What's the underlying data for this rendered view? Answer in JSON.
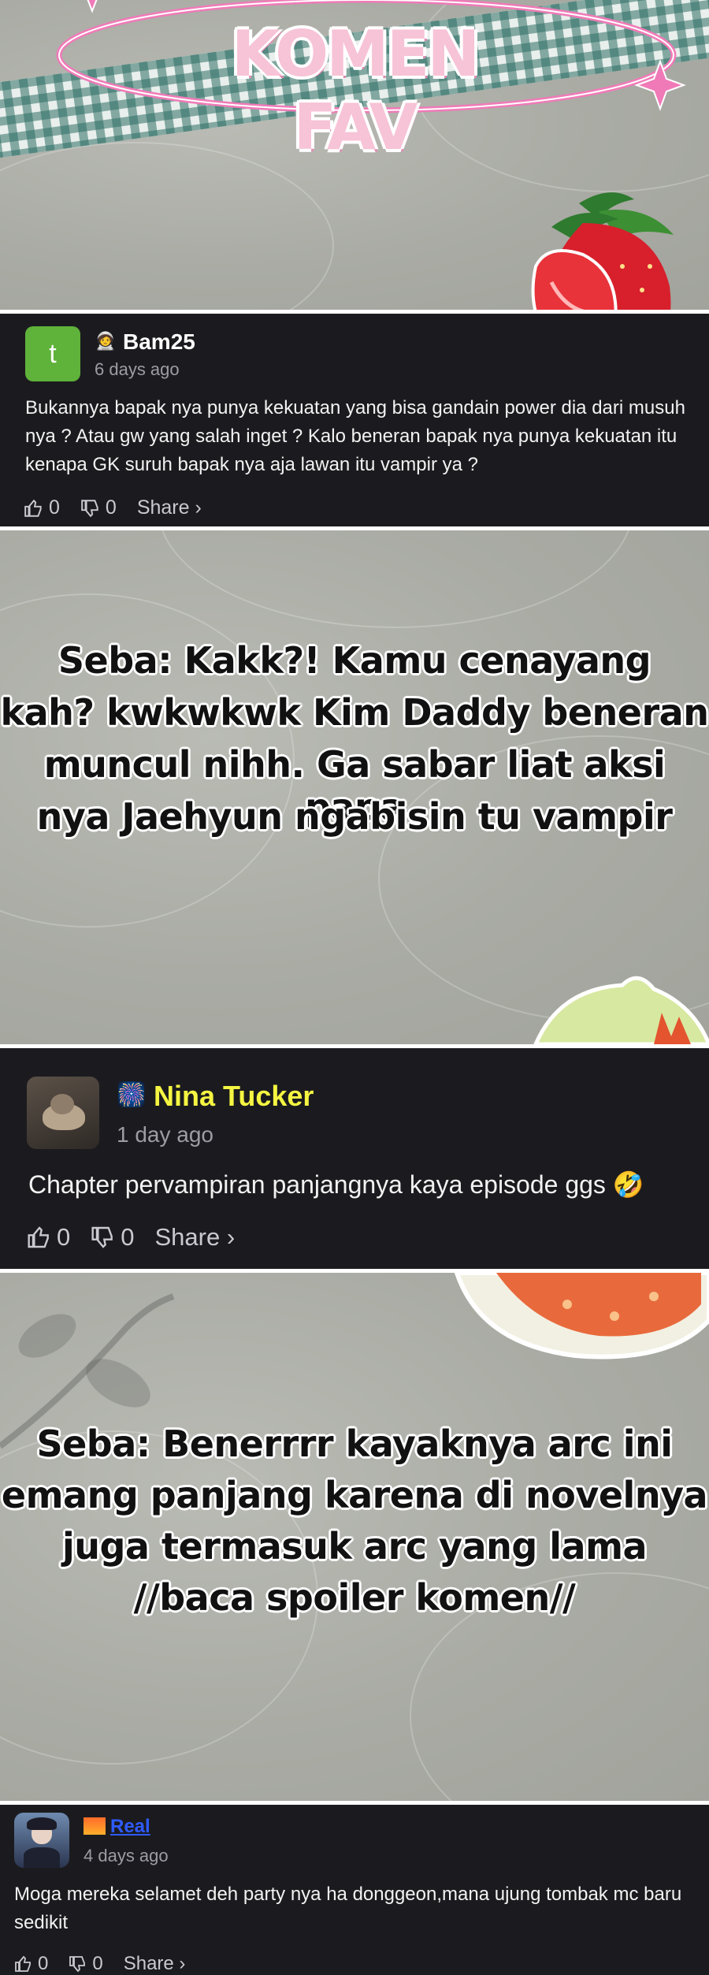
{
  "header": {
    "title": "KOMEN FAV"
  },
  "comments": [
    {
      "badge_icon": "person-emoji",
      "username": "Bam25",
      "avatar_letter": "t",
      "time": "6 days ago",
      "text": "Bukannya bapak nya punya kekuatan yang bisa gandain power dia dari musuh nya ? Atau gw yang salah inget ? Kalo beneran bapak nya punya kekuatan itu kenapa GK suruh bapak nya aja lawan itu vampir ya ?",
      "likes": "0",
      "dislikes": "0",
      "share": "Share ›"
    },
    {
      "badge_icon": "sparkle-emoji",
      "username": "Nina Tucker",
      "time": "1 day ago",
      "text": "Chapter pervampiran panjangnya kaya episode ggs 🤣",
      "likes": "0",
      "dislikes": "0",
      "share": "Share ›"
    },
    {
      "badge_icon": "sunset-emoji",
      "username": "Real",
      "time": "4 days ago",
      "text": "Moga mereka selamet deh party nya ha donggeon,mana ujung tombak mc baru sedikit",
      "likes": "0",
      "dislikes": "0",
      "share": "Share ›"
    }
  ],
  "replies": [
    {
      "lines": [
        "Seba: Kakk?! Kamu cenayang",
        "kah? kwkwkwk Kim Daddy beneran",
        "muncul nihh. Ga sabar liat aksi papa",
        "nya Jaehyun ngabisin tu vampir"
      ]
    },
    {
      "lines": [
        "Seba: Benerrrr kayaknya arc ini",
        "emang panjang karena di novelnya",
        "juga termasuk arc yang lama",
        "//baca spoiler komen//"
      ]
    }
  ],
  "colors": {
    "panel_bg": "#a9aba4",
    "comment_bg": "#1b1b1f",
    "avatar_green": "#5fb23a",
    "highlight_name": "#f5f542",
    "link_blue": "#2f5bff"
  }
}
